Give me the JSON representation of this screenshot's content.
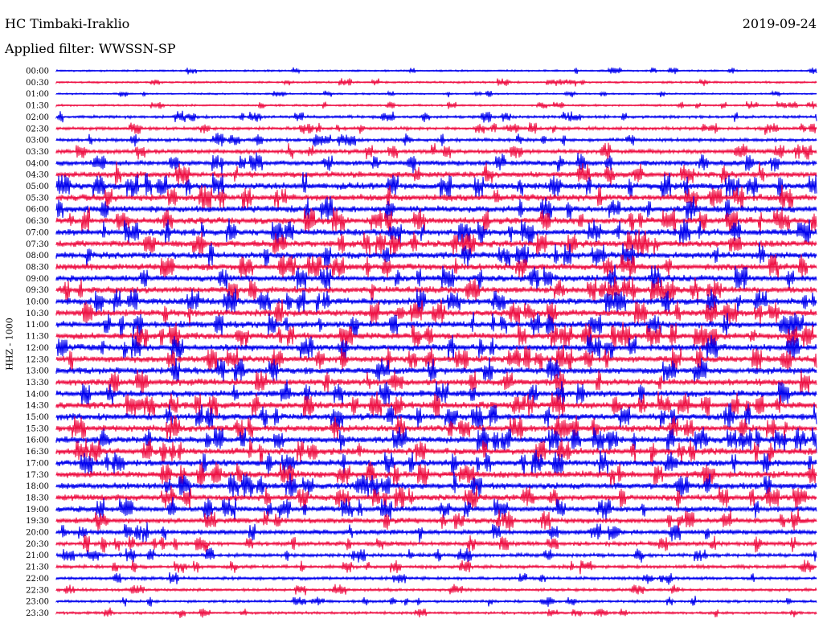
{
  "header": {
    "station": "HC Timbaki-Iraklio",
    "date": "2019-09-24",
    "filter": "Applied filter: WWSSN-SP",
    "channel_label": "HHZ - 1000"
  },
  "colors": {
    "series_a": "#0000ee",
    "series_b": "#ee1144",
    "background": "#ffffff",
    "text": "#000000"
  },
  "chart_data": {
    "type": "line",
    "chart_kind": "helicorder seismogram",
    "ylabel": "HHZ - 1000",
    "row_labels": [
      "00:00",
      "00:30",
      "01:00",
      "01:30",
      "02:00",
      "02:30",
      "03:00",
      "03:30",
      "04:00",
      "04:30",
      "05:00",
      "05:30",
      "06:00",
      "06:30",
      "07:00",
      "07:30",
      "08:00",
      "08:30",
      "09:00",
      "09:30",
      "10:00",
      "10:30",
      "11:00",
      "11:30",
      "12:00",
      "12:30",
      "13:00",
      "13:30",
      "14:00",
      "14:30",
      "15:00",
      "15:30",
      "16:00",
      "16:30",
      "17:00",
      "17:30",
      "18:00",
      "18:30",
      "19:00",
      "19:30",
      "20:00",
      "20:30",
      "21:00",
      "21:30",
      "22:00",
      "22:30",
      "23:00",
      "23:30"
    ],
    "row_colors": [
      "series_a",
      "series_b"
    ],
    "noise_level": [
      0.15,
      0.2,
      0.15,
      0.2,
      0.35,
      0.4,
      0.45,
      0.6,
      0.75,
      0.9,
      1.0,
      1.0,
      1.0,
      1.0,
      1.0,
      1.0,
      1.0,
      1.0,
      1.0,
      1.0,
      1.0,
      1.0,
      1.0,
      1.0,
      1.0,
      1.0,
      1.0,
      1.0,
      1.0,
      1.0,
      1.0,
      1.0,
      1.0,
      1.0,
      1.0,
      1.0,
      0.95,
      0.9,
      0.85,
      0.8,
      0.7,
      0.6,
      0.5,
      0.45,
      0.4,
      0.35,
      0.3,
      0.3
    ],
    "grid": false,
    "legend": "none"
  }
}
